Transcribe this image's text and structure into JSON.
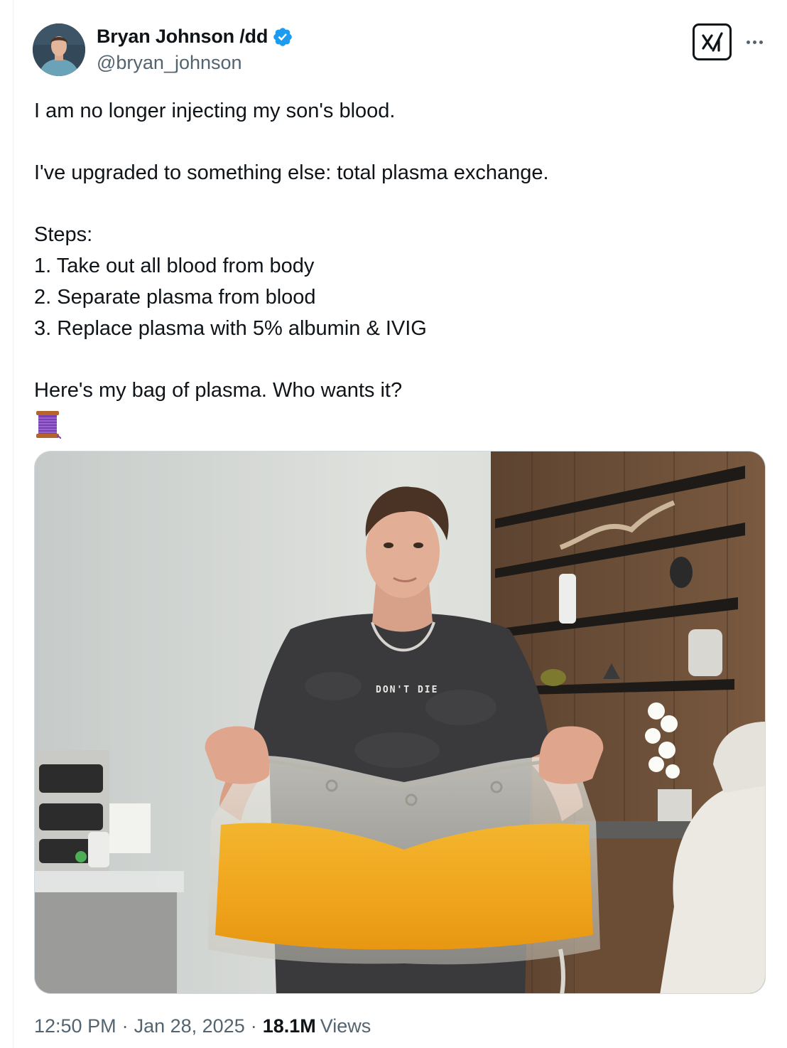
{
  "author": {
    "display_name": "Bryan Johnson /dd",
    "handle": "@bryan_johnson",
    "verified": true,
    "avatar_icon": "profile-avatar"
  },
  "actions": {
    "grok_icon": "grok-icon",
    "more_icon": "more-dots-icon"
  },
  "tweet": {
    "line_1": "I am no longer injecting my son's blood.",
    "line_2": "I've upgraded to something else: total plasma exchange.",
    "line_3": "Steps:",
    "line_4": "1. Take out all blood from body",
    "line_5": "2. Separate plasma from blood",
    "line_6": "3. Replace plasma with 5% albumin & IVIG",
    "line_7": "Here's my bag of plasma. Who wants it?",
    "emoji": "spool-of-thread-emoji"
  },
  "media": {
    "shirt_text": "DON'T DIE"
  },
  "footer": {
    "time": "12:50 PM",
    "date": "Jan 28, 2025",
    "views_count": "18.1M",
    "views_label": "Views",
    "separator": "·"
  },
  "colors": {
    "text": "#0f1419",
    "secondary": "#536471",
    "verified_blue": "#1d9bf0",
    "border": "#cfd9de"
  }
}
